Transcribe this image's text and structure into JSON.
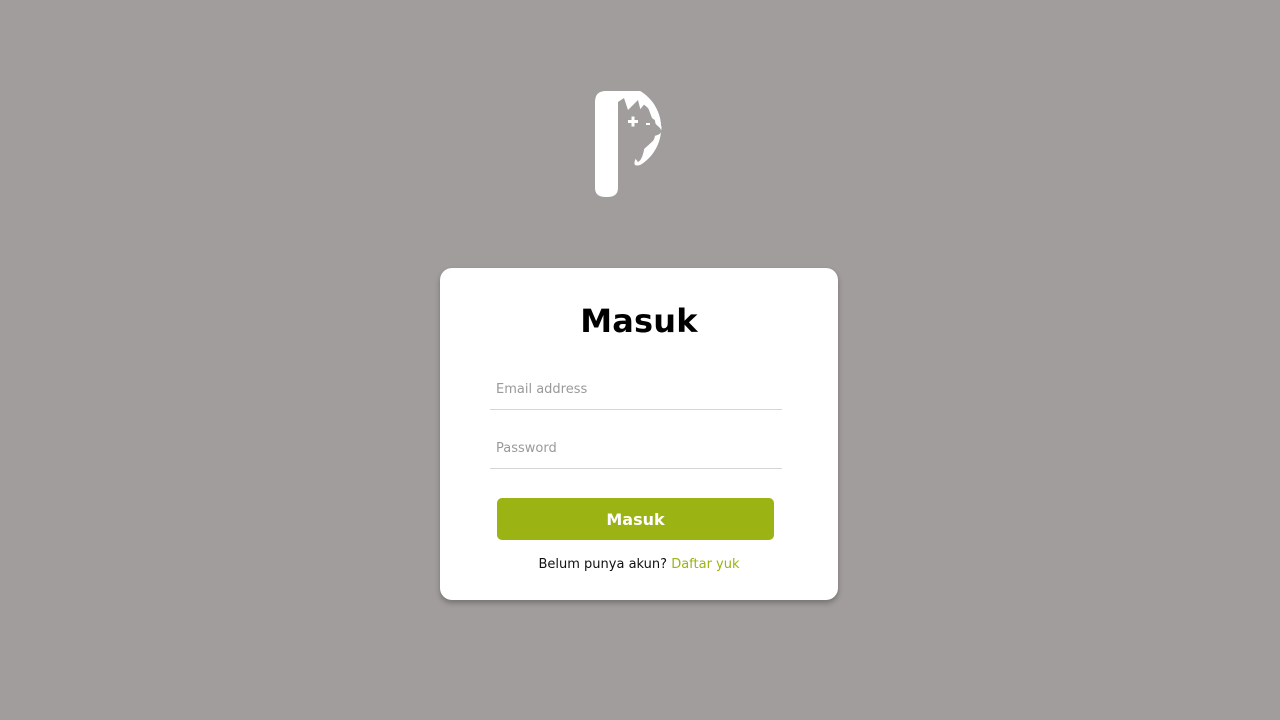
{
  "logo": {
    "icon": "pet-clinic-logo-icon"
  },
  "login": {
    "title": "Masuk",
    "email_placeholder": "Email address",
    "email_value": "",
    "password_placeholder": "Password",
    "password_value": "",
    "submit_label": "Masuk",
    "register_prompt": "Belum punya akun?",
    "register_link": "Daftar yuk"
  },
  "colors": {
    "background": "#a29d9d",
    "accent": "#9cb314",
    "card": "#ffffff"
  }
}
